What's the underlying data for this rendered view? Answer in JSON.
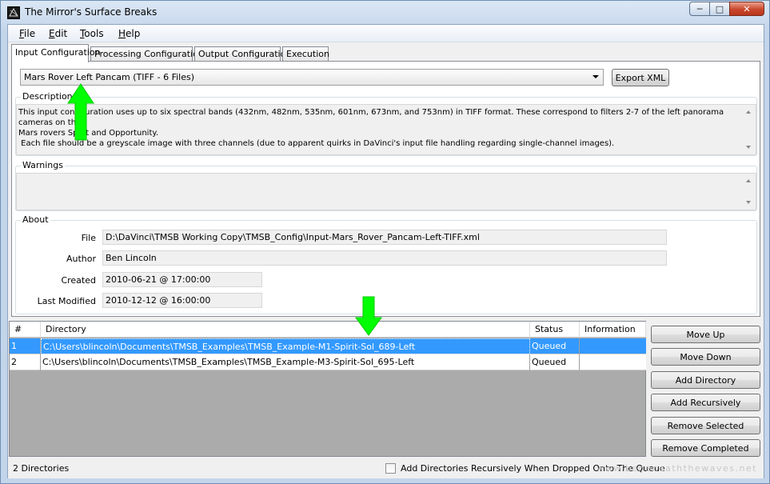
{
  "window": {
    "title": "The Mirror's Surface Breaks",
    "minimize_label": "─",
    "maximize_label": "□",
    "close_label": "✕",
    "icon": "app-icon"
  },
  "menu": {
    "items": [
      {
        "underlined": "F",
        "rest": "ile"
      },
      {
        "underlined": "E",
        "rest": "dit"
      },
      {
        "underlined": "T",
        "rest": "ools"
      },
      {
        "underlined": "H",
        "rest": "elp"
      }
    ]
  },
  "tabs": [
    {
      "label": "Input Configuration",
      "active": true
    },
    {
      "label": "Processing Configuration",
      "active": false
    },
    {
      "label": "Output Configuration",
      "active": false
    },
    {
      "label": "Execution",
      "active": false
    }
  ],
  "input_config": {
    "selected": "Mars Rover Left Pancam (TIFF - 6 Files)",
    "export_label": "Export XML"
  },
  "description": {
    "label": "Description",
    "line1": "This input configuration uses up to six spectral bands (432nm, 482nm, 535nm, 601nm, 673nm, and 753nm) in TIFF format. These correspond to filters 2-7 of the left panorama cameras on the",
    "line2": "Mars rovers Spirit and Opportunity.",
    "line3": " Each file should be a greyscale image with three channels (due to apparent quirks in DaVinci's input file handling regarding single-channel images)."
  },
  "warnings": {
    "label": "Warnings",
    "text": ""
  },
  "about": {
    "label": "About",
    "file_label": "File",
    "file_value": "D:\\DaVinci\\TMSB Working Copy\\TMSB_Config\\Input-Mars_Rover_Pancam-Left-TIFF.xml",
    "author_label": "Author",
    "author_value": "Ben Lincoln",
    "created_label": "Created",
    "created_value": "2010-06-21 @ 17:00:00",
    "modified_label": "Last Modified",
    "modified_value": "2010-12-12 @ 16:00:00"
  },
  "queue": {
    "columns": {
      "num": "#",
      "directory": "Directory",
      "status": "Status",
      "information": "Information"
    },
    "rows": [
      {
        "num": "1",
        "directory": "C:\\Users\\blincoln\\Documents\\TMSB_Examples\\TMSB_Example-M1-Spirit-Sol_689-Left",
        "status": "Queued",
        "information": "",
        "selected": true
      },
      {
        "num": "2",
        "directory": "C:\\Users\\blincoln\\Documents\\TMSB_Examples\\TMSB_Example-M3-Spirit-Sol_695-Left",
        "status": "Queued",
        "information": "",
        "selected": false
      }
    ]
  },
  "buttons": {
    "move_up": "Move Up",
    "move_down": "Move Down",
    "add_directory": "Add Directory",
    "add_recursively": "Add Recursively",
    "remove_selected": "Remove Selected",
    "remove_completed": "Remove Completed"
  },
  "status": {
    "count": "2 Directories",
    "recursive_checkbox_label": "Add Directories Recursively When Dropped Onto The Queue",
    "recursive_checked": false
  },
  "watermark": "www.beneneaththewaves.net",
  "colors": {
    "selection": "#3399ff",
    "annotation_arrow": "#00ff00"
  }
}
